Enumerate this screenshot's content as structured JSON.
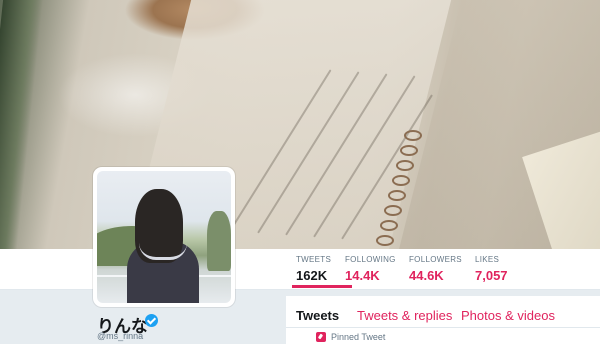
{
  "profile": {
    "display_name": "りんな",
    "handle": "@ms_rinna",
    "verified": true
  },
  "stats": [
    {
      "label": "TWEETS",
      "value": "162K",
      "active": true
    },
    {
      "label": "FOLLOWING",
      "value": "14.4K",
      "active": false
    },
    {
      "label": "FOLLOWERS",
      "value": "44.6K",
      "active": false
    },
    {
      "label": "LIKES",
      "value": "7,057",
      "active": false
    }
  ],
  "tabs": [
    {
      "label": "Tweets",
      "active": true
    },
    {
      "label": "Tweets & replies",
      "active": false
    },
    {
      "label": "Photos & videos",
      "active": false
    }
  ],
  "pinned": {
    "label": "Pinned Tweet",
    "icon": "pin-icon"
  },
  "colors": {
    "accent": "#e0245e",
    "verified": "#1da1f2",
    "text": "#14171a",
    "muted": "#657786"
  }
}
